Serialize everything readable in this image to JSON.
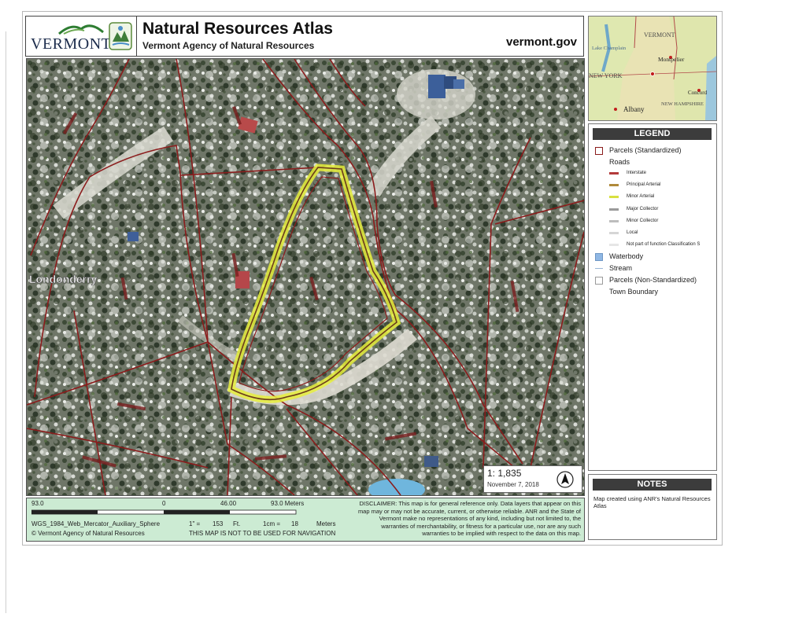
{
  "header": {
    "logo_text": "VERMONT",
    "title": "Natural Resources Atlas",
    "subtitle": "Vermont Agency of Natural Resources",
    "site": "vermont.gov"
  },
  "inset_map": {
    "labels": [
      "VERMONT",
      "Lake Champlain",
      "Montpelier",
      "NEW YORK",
      "NEW HAMPSHIRE",
      "Concord",
      "Albany"
    ]
  },
  "map": {
    "town_label": "Londonderry",
    "scale_text": "1: 1,835",
    "date": "November 7, 2018",
    "colors": {
      "parcel": "#8b1c1c",
      "highlight": "#e6ee3c",
      "water": "#6fb6dd"
    }
  },
  "legend": {
    "title": "LEGEND",
    "items": [
      {
        "label": "Parcels (Standardized)",
        "swatch": "box",
        "color": "#8b1c1c"
      },
      {
        "label": "Roads",
        "swatch": "none"
      },
      {
        "label": "Interstate",
        "swatch": "line",
        "color": "#b33a3a",
        "small": true
      },
      {
        "label": "Principal Arterial",
        "swatch": "line",
        "color": "#b08a3a",
        "small": true
      },
      {
        "label": "Minor Arterial",
        "swatch": "line",
        "color": "#d8e040",
        "small": true
      },
      {
        "label": "Major Collector",
        "swatch": "line",
        "color": "#9a9a9a",
        "small": true
      },
      {
        "label": "Minor Collector",
        "swatch": "line",
        "color": "#bdbdbd",
        "small": true
      },
      {
        "label": "Local",
        "swatch": "line",
        "color": "#d6d6d6",
        "small": true
      },
      {
        "label": "Not part of function Classification S",
        "swatch": "line",
        "color": "#e6e6e6",
        "small": true
      },
      {
        "label": "Waterbody",
        "swatch": "water",
        "color": "#6fa8dc"
      },
      {
        "label": "Stream",
        "swatch": "thin",
        "color": "#9ab7d6"
      },
      {
        "label": "Parcels (Non-Standardized)",
        "swatch": "box",
        "color": "#9a9a9a"
      },
      {
        "label": "Town Boundary",
        "swatch": "none"
      }
    ]
  },
  "notes": {
    "title": "NOTES",
    "text": "Map created using ANR's Natural Resources Atlas"
  },
  "scale_bar": {
    "left_value": "93.0",
    "zero": "0",
    "mid_value": "46.00",
    "right_value": "93.0 Meters",
    "projection": "WGS_1984_Web_Mercator_Auxiliary_Sphere",
    "inch_label": "1\" =",
    "inch_value": "153",
    "inch_unit": "Ft.",
    "cm_label": "1cm =",
    "cm_value": "18",
    "cm_unit": "Meters",
    "copyright": "© Vermont Agency of Natural Resources",
    "nav_warning": "THIS MAP IS NOT TO BE USED FOR NAVIGATION"
  },
  "disclaimer": "DISCLAIMER: This map is for general reference only. Data layers that appear on this map may or may not be accurate, current, or otherwise reliable. ANR and the State of Vermont make no representations of any kind, including but not limited to, the warranties of merchantability, or fitness for a particular use, nor are any such warranties to be implied with respect to the data on this map."
}
